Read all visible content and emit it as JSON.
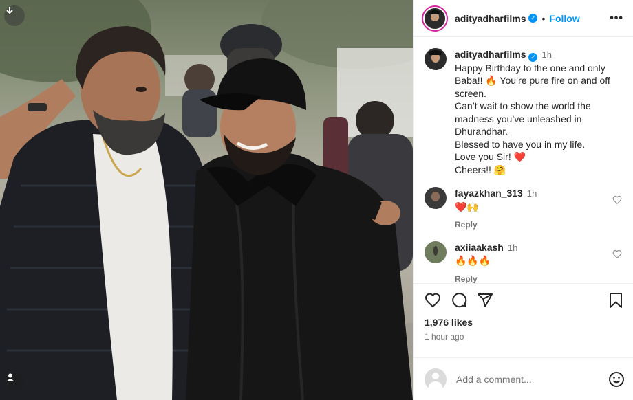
{
  "post": {
    "username": "adityadharfilms",
    "follow_label": "Follow",
    "more_label": "•••",
    "caption_time": "1h",
    "caption_lines": [
      "Happy Birthday to the one and only",
      "Baba!! 🔥  You’re pure fire on and off",
      "screen.",
      "Can’t wait to show the world the",
      "madness you’ve unleashed in",
      "Dhurandhar.",
      "Blessed to have you in my life.",
      "Love you Sir! ❤️",
      "Cheers!! 🤗"
    ],
    "likes": "1,976 likes",
    "posted_ago": "1 hour ago"
  },
  "comments": [
    {
      "username": "fayazkhan_313",
      "time": "1h",
      "text": "❤️🙌",
      "reply_label": "Reply"
    },
    {
      "username": "axiiaakash",
      "time": "1h",
      "text": "🔥🔥🔥",
      "reply_label": "Reply"
    }
  ],
  "composer": {
    "placeholder": "Add a comment..."
  },
  "icons": {
    "download": "download-icon",
    "tag": "user-tag-icon",
    "like": "heart-outline-icon",
    "comment": "comment-bubble-icon",
    "share": "paper-plane-icon",
    "save": "bookmark-icon",
    "emoji": "smiley-icon"
  },
  "colors": {
    "accent": "#0095f6",
    "text": "#262626",
    "secondary": "#737373",
    "heart": "#e0245e"
  }
}
